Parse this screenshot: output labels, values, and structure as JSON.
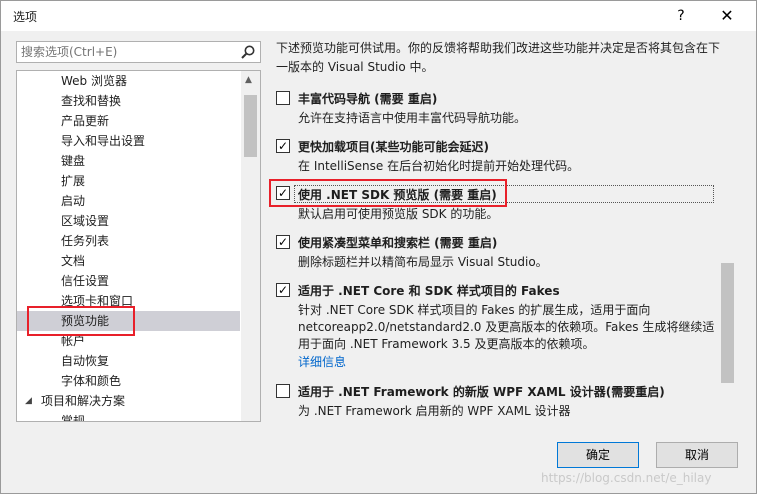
{
  "window": {
    "title": "选项",
    "help_glyph": "?",
    "close_glyph": "✕"
  },
  "search": {
    "placeholder": "搜索选项(Ctrl+E)"
  },
  "tree": {
    "items": [
      {
        "label": "Web 浏览器"
      },
      {
        "label": "查找和替换"
      },
      {
        "label": "产品更新"
      },
      {
        "label": "导入和导出设置"
      },
      {
        "label": "键盘"
      },
      {
        "label": "扩展"
      },
      {
        "label": "启动"
      },
      {
        "label": "区域设置"
      },
      {
        "label": "任务列表"
      },
      {
        "label": "文档"
      },
      {
        "label": "信任设置"
      },
      {
        "label": "选项卡和窗口"
      },
      {
        "label": "预览功能",
        "selected": true
      },
      {
        "label": "帐户"
      },
      {
        "label": "自动恢复"
      },
      {
        "label": "字体和颜色"
      },
      {
        "label": "项目和解决方案",
        "group": true,
        "expander": "◢"
      },
      {
        "label": "常规"
      }
    ]
  },
  "main": {
    "description": "下述预览功能可供试用。你的反馈将帮助我们改进这些功能并决定是否将其包含在下一版本的 Visual Studio 中。",
    "options": [
      {
        "title": "丰富代码导航 (需要 重启)",
        "checked": false,
        "desc": "允许在支持语言中使用丰富代码导航功能。"
      },
      {
        "title": "更快加载项目(某些功能可能会延迟)",
        "checked": true,
        "desc": "在 IntelliSense 在后台初始化时提前开始处理代码。"
      },
      {
        "title": "使用 .NET SDK 预览版 (需要 重启)",
        "checked": true,
        "desc": "默认启用可使用预览版 SDK 的功能。"
      },
      {
        "title": "使用紧凑型菜单和搜索栏 (需要 重启)",
        "checked": true,
        "desc": "删除标题栏并以精简布局显示 Visual Studio。"
      },
      {
        "title": "适用于 .NET Core 和 SDK 样式项目的 Fakes",
        "checked": true,
        "desc": "针对 .NET Core SDK 样式项目的 Fakes 的扩展生成，适用于面向 netcoreapp2.0/netstandard2.0 及更高版本的依赖项。Fakes 生成将继续适用于面向 .NET Framework 3.5 及更高版本的依赖项。",
        "link": "详细信息"
      },
      {
        "title": "适用于 .NET Framework 的新版 WPF XAML 设计器(需要重启)",
        "checked": false,
        "desc": "为 .NET Framework 启用新的 WPF XAML 设计器"
      }
    ]
  },
  "buttons": {
    "ok": "确定",
    "cancel": "取消"
  },
  "watermark": "https://blog.csdn.net/e_hilay"
}
